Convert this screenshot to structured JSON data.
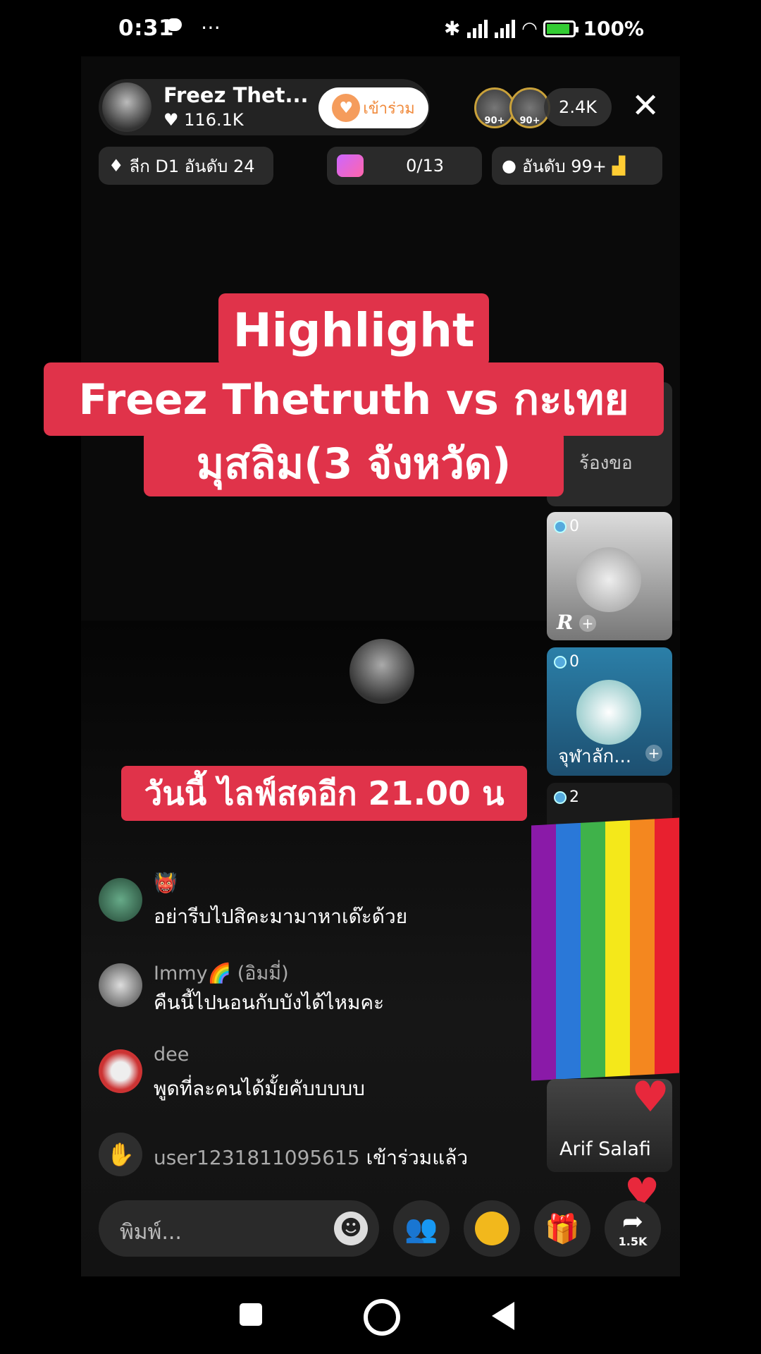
{
  "status_bar": {
    "time": "0:31",
    "extra": "⋯",
    "battery": "100%"
  },
  "host": {
    "name": "Freez Thet...",
    "likes": "116.1K",
    "join_label": "เข้าร่วม"
  },
  "viewers": {
    "badge1": "90+",
    "badge2": "90+",
    "count": "2.4K"
  },
  "chips": {
    "league": "ลีก D1 อันดับ 24",
    "goal": "0/13",
    "rank": "อันดับ 99+"
  },
  "captions": {
    "line1": "Highlight",
    "line2": "Freez Thetruth vs กะเทย",
    "line3": "มุสลิม(3 จังหวัด)",
    "line4": "วันนี้ ไลฟ์สดอีก 21.00 น"
  },
  "side_panel": {
    "request_label": "ร้องขอ",
    "cards": [
      {
        "coins": "0",
        "label": "R"
      },
      {
        "coins": "0",
        "label": "จุฬาลัก..."
      },
      {
        "coins": "2",
        "label": ""
      }
    ],
    "bottom_card_label": "Arif Salafi"
  },
  "chat": [
    {
      "name": "👹",
      "message": "อย่ารีบไปสิคะมามาหาเด๊ะด้วย"
    },
    {
      "name": "Immy🌈 (อิมมี่)",
      "message": "คืนนี้ไปนอนกับบังได้ไหมคะ"
    },
    {
      "name": "dee",
      "message": "พูดที่ละคนได้มั้ยคับบบบบ"
    }
  ],
  "join_notice": {
    "user": "user1231811095615",
    "text": "เข้าร่วมแล้ว"
  },
  "input": {
    "placeholder": "พิมพ์..."
  },
  "share_count": "1.5K",
  "colors": {
    "caption_red": "#e0334a",
    "accent_pink": "#ff2d6f"
  }
}
